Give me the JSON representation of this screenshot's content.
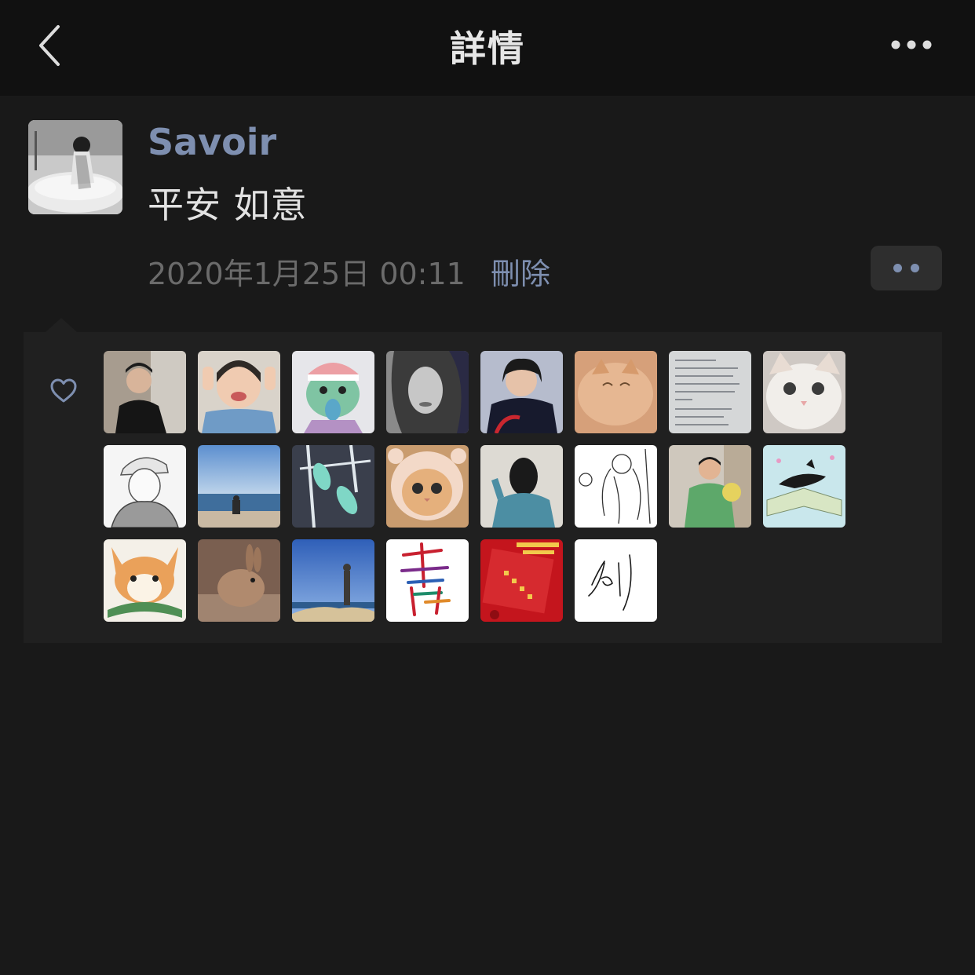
{
  "header": {
    "title": "詳情",
    "back_icon": "chevron-left-icon",
    "more_icon": "more-dots-icon"
  },
  "post": {
    "nickname": "Savoir",
    "text": "平安 如意",
    "time": "2020年1月25日 00:11",
    "delete_label": "刪除",
    "action_icon": "comment-like-dots-icon"
  },
  "likes": {
    "icon": "heart-outline-icon",
    "avatars": [
      "man-portrait",
      "smiling-girl",
      "green-plush-toy",
      "sketch-woman",
      "woman-with-scissors",
      "orange-cat",
      "handwritten-note",
      "white-kitten",
      "anime-boy-sketch",
      "seaside-person",
      "teal-abstract",
      "cat-in-hood",
      "girl-back-view",
      "line-art-figure",
      "child-with-toy",
      "whale-book-illustration",
      "corgi-illustration",
      "brown-rabbit",
      "man-on-rock",
      "calligraphy-qing",
      "red-envelope",
      "signature-sketch"
    ]
  },
  "colors": {
    "background": "#191919",
    "nav_background": "#111111",
    "link": "#7e8fb0",
    "panel": "#202020"
  }
}
